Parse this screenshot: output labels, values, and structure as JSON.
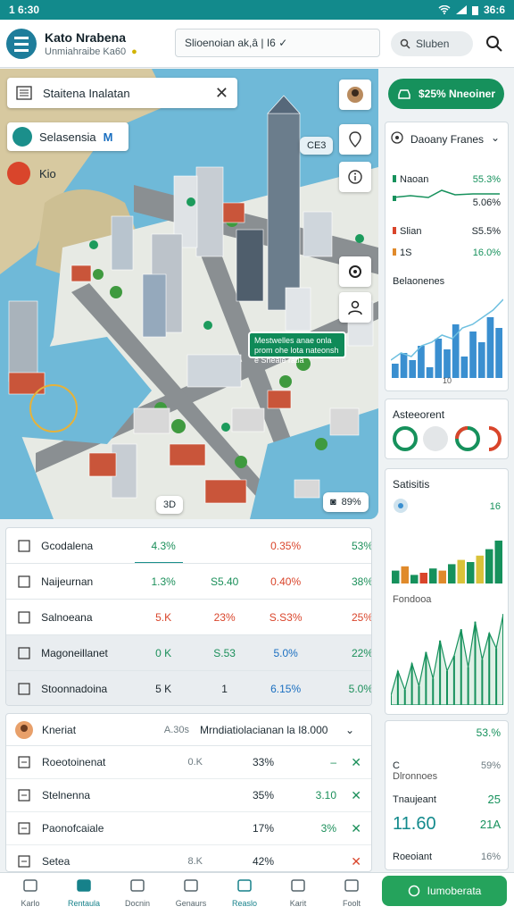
{
  "status": {
    "time": "1 6:30",
    "right": "36:6"
  },
  "app": {
    "title": "Kato Nrabena",
    "subtitle": "Unmiahraibe Ka60",
    "address": "Slioenoian ak,â | I6 ✓",
    "search_label": "Sluben"
  },
  "map": {
    "search_text": "Staitena Inalatan",
    "chip_label": "Selasensia",
    "chip_mark": "M",
    "chip2_label": "Kio",
    "tag_top": "CE3",
    "tag_bottom_left": "3D",
    "tag_bottom_right": "89%",
    "green_label": "Mestwelles anae onla prom ohe lota nateonsh e Sheale ratia",
    "icons": [
      "person-icon",
      "marker-icon",
      "info-icon",
      "location-icon",
      "user-icon"
    ]
  },
  "table": {
    "rows": [
      {
        "name": "Gcodalena",
        "c1": "4.3%",
        "c2": "0.35%",
        "c3": "53%",
        "c1_color": "#1b8f5a",
        "c2_color": "#d9452b",
        "c3_color": "#1b8f5a"
      },
      {
        "name": "Naijeurnan",
        "c1": "1.3%",
        "c1b": "S5.40",
        "c2": "0.40%",
        "c3": "38%",
        "c1_color": "#1b8f5a",
        "c2_color": "#d9452b",
        "c3_color": "#1b8f5a"
      },
      {
        "name": "Salnoeana",
        "c1": "5.K",
        "c1b": "23%",
        "c2": "S.S3%",
        "c3": "25%",
        "c1_color": "#d9452b",
        "c2_color": "#d9452b",
        "c3_color": "#d9452b"
      },
      {
        "name": "Magoneillanet",
        "c1": "0 K",
        "c1b": "S.53",
        "c2": "5.0%",
        "c3": "22%",
        "c1_color": "#1b8f5a",
        "c2_color": "#1a6fc0",
        "c3_color": "#1b8f5a"
      },
      {
        "name": "Stoonnadoina",
        "c1": "5 K",
        "c1b": "1",
        "c2": "6.15%",
        "c3": "5.0%",
        "c1_color": "#1b262c",
        "c2_color": "#1a6fc0",
        "c3_color": "#1b8f5a"
      }
    ]
  },
  "list": {
    "header": {
      "name": "Kneriat",
      "qty": "A.30s",
      "desc": "Mrndiatiolacianan la I8.000"
    },
    "rows": [
      {
        "name": "Roeotoinenat",
        "qty": "0.K",
        "pct": "33%",
        "val": "–",
        "act": "✕"
      },
      {
        "name": "Stelnenna",
        "qty": "",
        "pct": "35%",
        "val": "3.10",
        "act": "✕"
      },
      {
        "name": "Paonofcaiale",
        "qty": "",
        "pct": "17%",
        "val": "3%",
        "act": "✕"
      },
      {
        "name": "Setea",
        "qty": "8.K",
        "pct": "42%",
        "val": "",
        "act": "✕"
      }
    ]
  },
  "side": {
    "primary_button": "$25% Nneoiner",
    "card1": {
      "title": "Daoany Franes",
      "m1_label": "Naoan",
      "m1_val": "55.3%",
      "m1_val2": "5.06%",
      "m2_label": "Slian",
      "m2_val": "S5.5%",
      "m3_label": "1S",
      "m3_val": "16.0%",
      "m4_label": "Belaonenes",
      "axis_tick": "10"
    },
    "card2": {
      "title": "Asteeorent"
    },
    "card3": {
      "title": "Satisitis",
      "value": "16",
      "label2": "Fondooa"
    },
    "card4": {
      "v1": "53.%",
      "label_c": "C",
      "v2": "59%",
      "label_d": "Dlronnoes",
      "label_t": "Tnaujeant",
      "v3": "25",
      "big": "11.60",
      "v4": "21A",
      "label_p": "Roeoiant",
      "v5": "16%"
    }
  },
  "chart_data": [
    {
      "type": "bar",
      "series": [
        {
          "values": [
            8,
            14,
            10,
            18,
            6,
            22,
            16,
            30,
            12,
            26,
            20,
            34,
            28
          ]
        }
      ],
      "categories": [
        "",
        "",
        "",
        "",
        "",
        "",
        "",
        "",
        "",
        "",
        "",
        "",
        ""
      ],
      "line_overlay": [
        10,
        14,
        12,
        18,
        20,
        24,
        22,
        28,
        30,
        34,
        38,
        44
      ],
      "ylim": [
        0,
        50
      ]
    },
    {
      "type": "bar",
      "series": [
        {
          "name": "",
          "values": [
            12,
            16,
            8,
            10,
            14,
            12,
            18,
            22,
            20,
            26,
            32,
            40
          ]
        }
      ],
      "ylim": [
        0,
        50
      ]
    },
    {
      "type": "line",
      "series": [
        {
          "values": [
            5,
            18,
            8,
            22,
            10,
            28,
            14,
            34,
            18,
            26,
            40,
            20,
            44,
            24,
            38,
            30,
            48
          ]
        }
      ],
      "ylim": [
        0,
        50
      ]
    }
  ],
  "bottom_nav": {
    "items": [
      "Karlo",
      "Rentaula",
      "Docnin",
      "Genaurs",
      "Reaslo",
      "Karit",
      "Foolt"
    ],
    "cta": "Iumoberata"
  },
  "colors": {
    "accent": "#16915c",
    "teal": "#128a8c",
    "red": "#d9452b",
    "blue": "#3a8fd0"
  }
}
